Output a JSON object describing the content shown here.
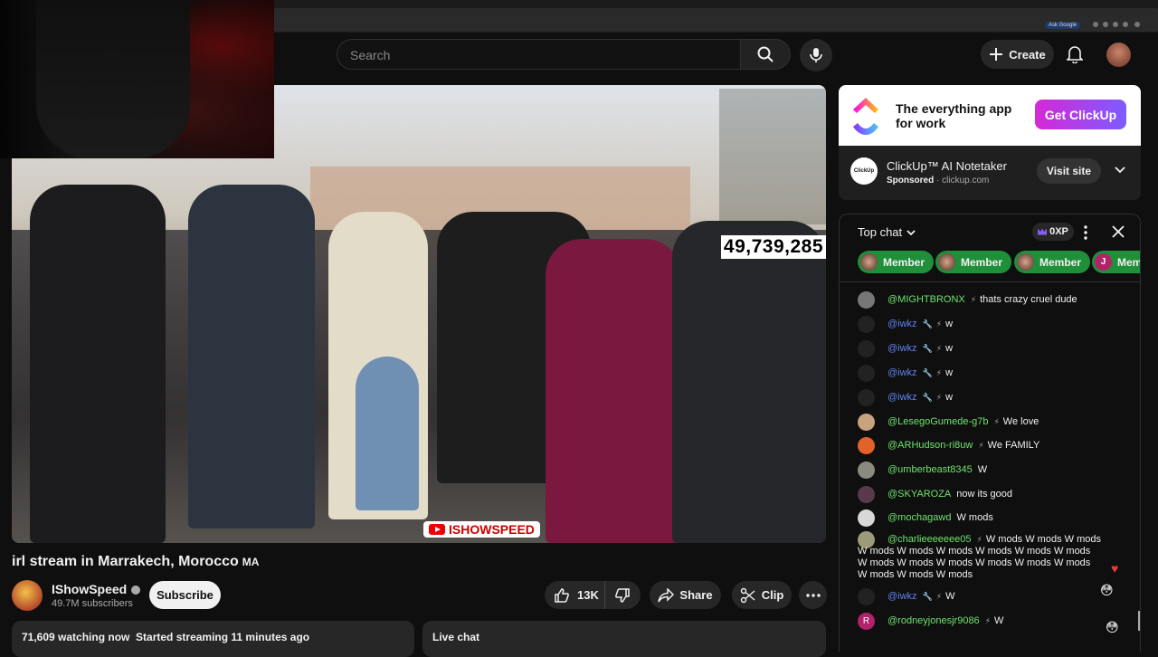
{
  "browser": {
    "ask_google": "Ask Google"
  },
  "masthead": {
    "search_placeholder": "Search",
    "create_label": "Create"
  },
  "video": {
    "viewer_overlay": "49,739,285",
    "watermark": "ISHOWSPEED",
    "title": "irl stream in Marrakech, Morocco",
    "title_flag": "MA"
  },
  "channel": {
    "name": "IShowSpeed",
    "subscribers": "49.7M subscribers",
    "subscribe_label": "Subscribe"
  },
  "actions": {
    "likes": "13K",
    "share_label": "Share",
    "clip_label": "Clip"
  },
  "description": {
    "watching": "71,609 watching now",
    "started": "Started streaming 11 minutes ago"
  },
  "live_chat_label": "Live chat",
  "ad": {
    "tagline": "The everything app for work",
    "cta": "Get ClickUp",
    "avatar_text": "ClickUp",
    "title": "ClickUp™ AI Notetaker",
    "sponsored": "Sponsored",
    "domain": "clickup.com",
    "visit_label": "Visit site",
    "brand_colors": [
      "#7b68ee",
      "#ff02f0",
      "#49ccf9",
      "#ffc800"
    ]
  },
  "chat": {
    "mode_label": "Top chat",
    "xp_label": "0XP",
    "member_chips": [
      {
        "label": "Member"
      },
      {
        "label": "Member"
      },
      {
        "label": "Member"
      },
      {
        "label": "Member",
        "initial": "J"
      }
    ],
    "messages": [
      {
        "author": "@MIGHTBRONX",
        "text": "thats crazy cruel dude",
        "role": "member"
      },
      {
        "author": "@iwkz",
        "text": "w",
        "role": "moderator"
      },
      {
        "author": "@iwkz",
        "text": "w",
        "role": "moderator"
      },
      {
        "author": "@iwkz",
        "text": "w",
        "role": "moderator"
      },
      {
        "author": "@iwkz",
        "text": "w",
        "role": "moderator"
      },
      {
        "author": "@LesegoGumede-g7b",
        "text": "We love",
        "role": "member"
      },
      {
        "author": "@ARHudson-ri8uw",
        "text": "We FAMILY",
        "role": "member"
      },
      {
        "author": "@umberbeast8345",
        "text": "W",
        "role": "member"
      },
      {
        "author": "@SKYAROZA",
        "text": "now its good",
        "role": "member"
      },
      {
        "author": "@mochagawd",
        "text": "W mods",
        "role": "member"
      },
      {
        "author": "@charlieeeeeee05",
        "text": "W mods W mods W mods W mods W mods W mods W mods W mods W mods W mods W mods W mods W mods W mods W mods W mods W mods W mods",
        "role": "member"
      },
      {
        "author": "@iwkz",
        "text": "W",
        "role": "moderator"
      },
      {
        "author": "@rodneyjonesjr9086",
        "text": "W",
        "role": "member",
        "initial": "R"
      }
    ]
  }
}
